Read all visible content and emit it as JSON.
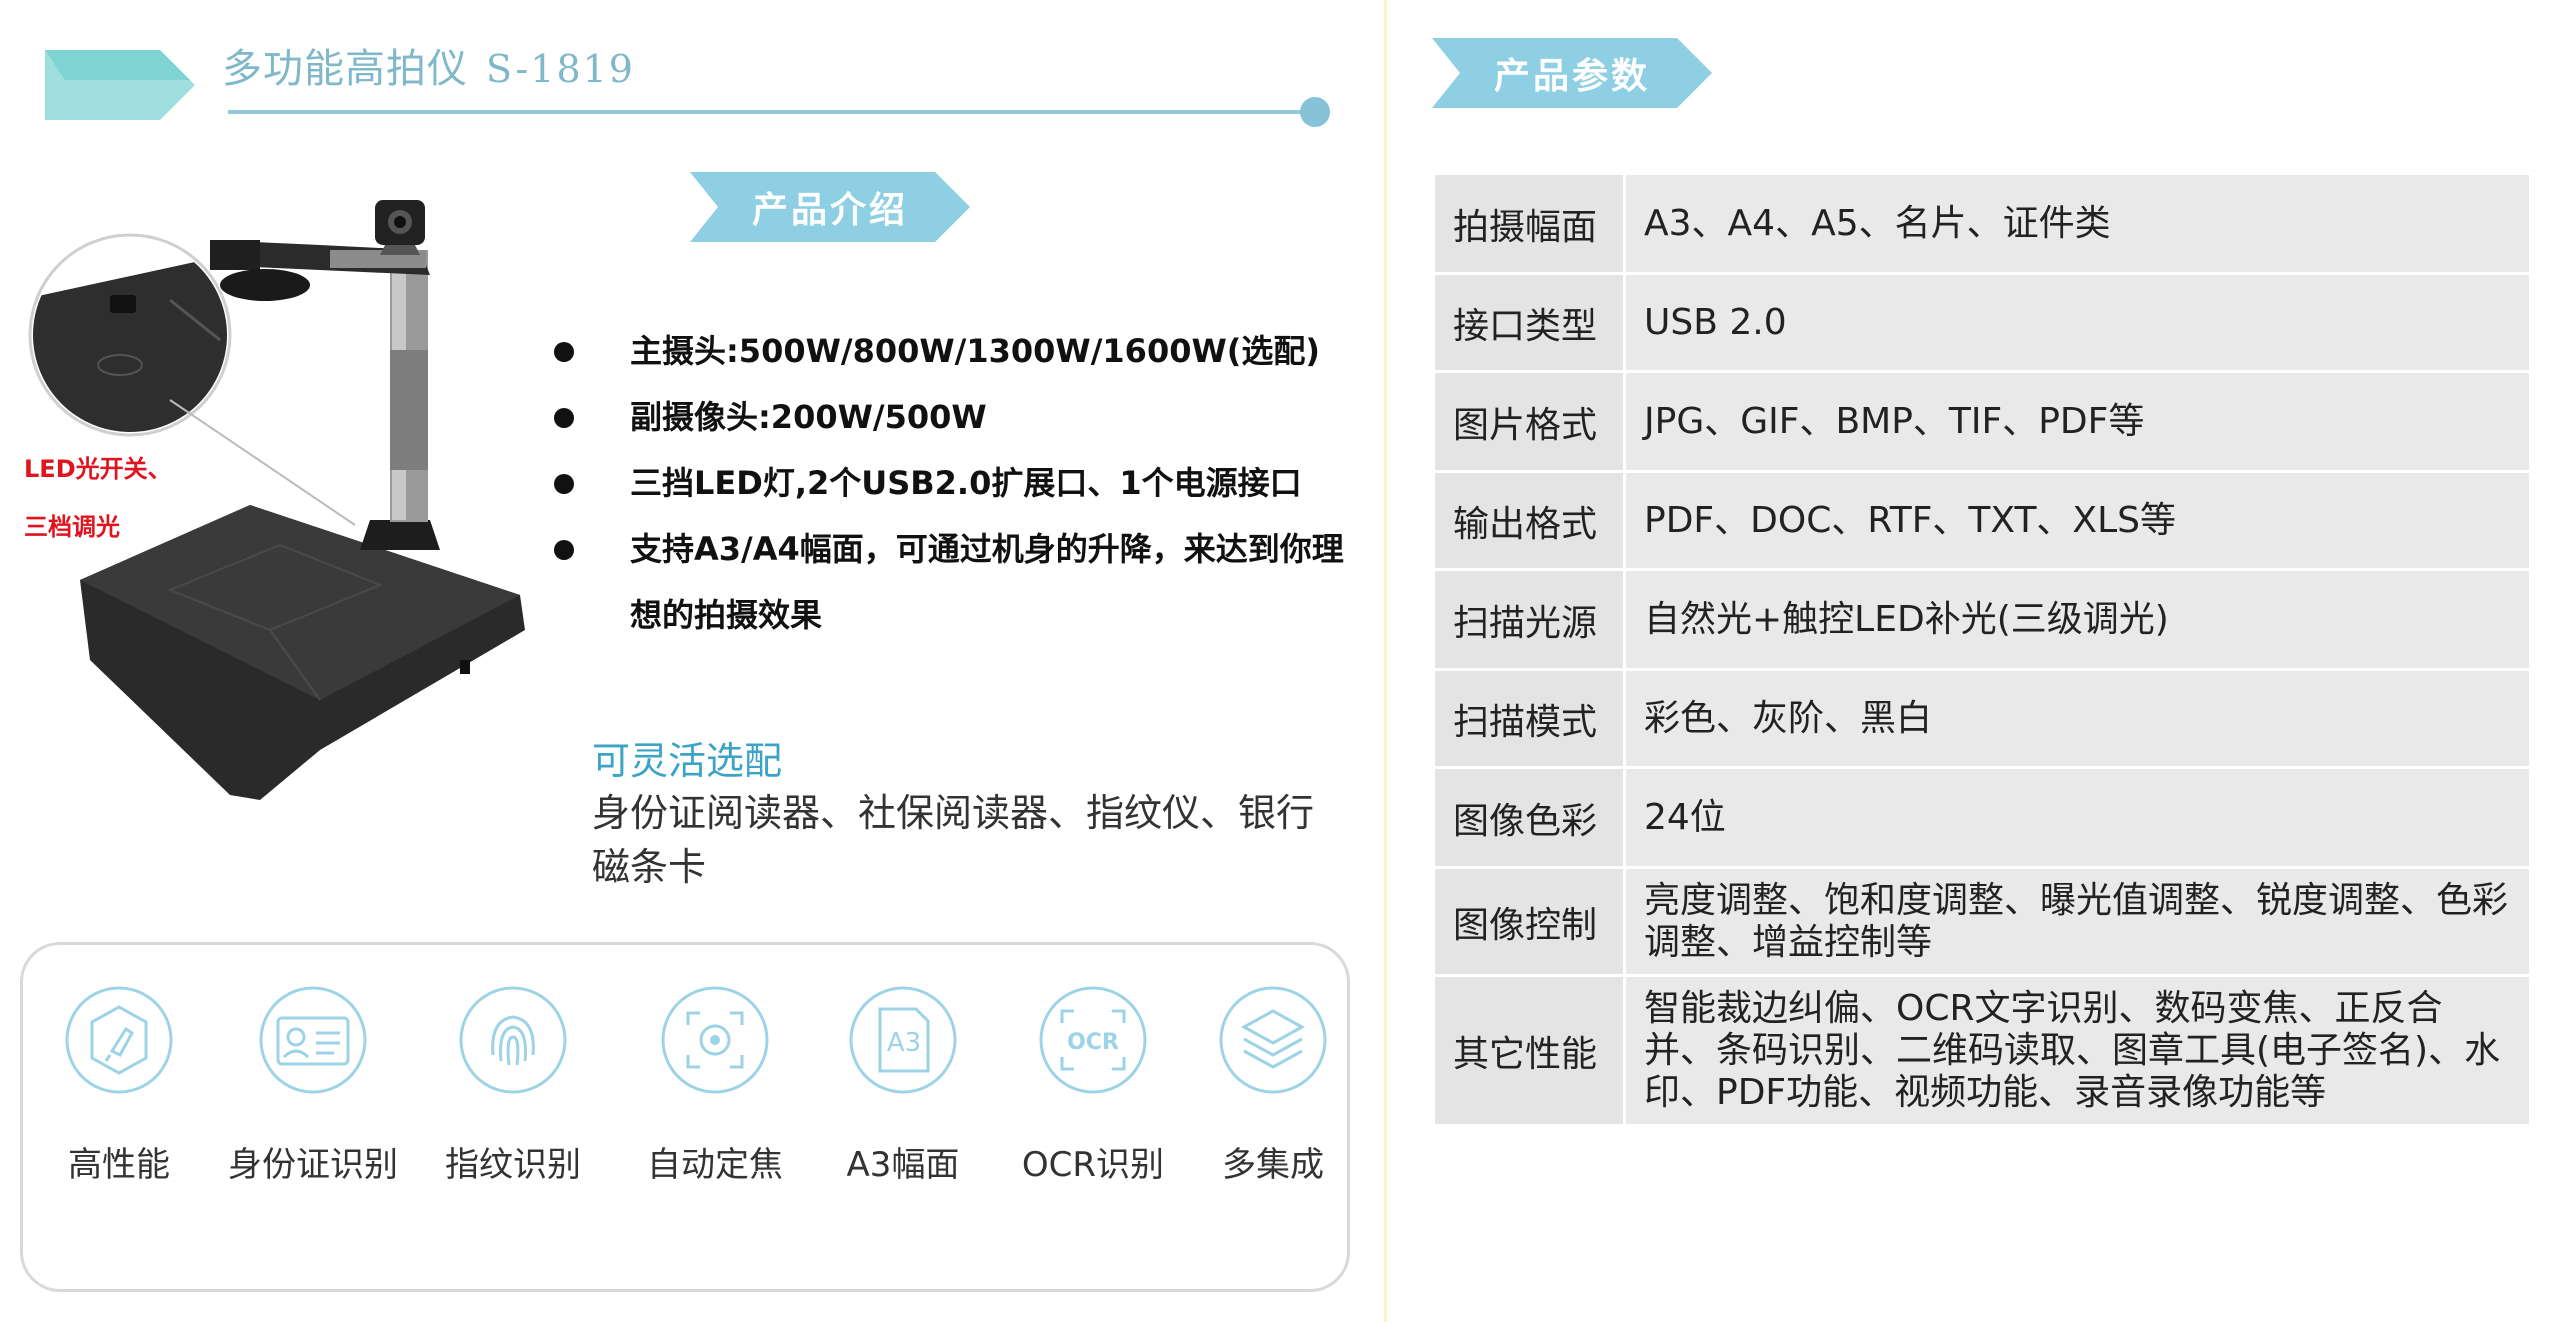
{
  "header": {
    "title": "多功能高拍仪",
    "model": "S-1819"
  },
  "sections": {
    "intro": "产品介绍",
    "params": "产品参数"
  },
  "device_note": {
    "line1": "LED光开关、",
    "line2": "三档调光"
  },
  "features": [
    "主摄头:500W/800W/1300W/1600W(选配)",
    "副摄像头:200W/500W",
    "三挡LED灯,2个USB2.0扩展口、1个电源接口",
    "支持A3/A4幅面，可通过机身的升降，来达到你理想的拍摄效果"
  ],
  "options": {
    "title": "可灵活选配",
    "text": "身份证阅读器、社保阅读器、指纹仪、银行磁条卡"
  },
  "icons": [
    {
      "name": "rocket-icon",
      "label": "高性能"
    },
    {
      "name": "id-card-icon",
      "label": "身份证识别"
    },
    {
      "name": "fingerprint-icon",
      "label": "指纹识别"
    },
    {
      "name": "focus-icon",
      "label": "自动定焦"
    },
    {
      "name": "a3-icon",
      "label": "A3幅面",
      "glyph": "A3"
    },
    {
      "name": "ocr-icon",
      "label": "OCR识别",
      "glyph": "OCR"
    },
    {
      "name": "layers-icon",
      "label": "多集成"
    }
  ],
  "specs": [
    {
      "key": "拍摄幅面",
      "value": "A3、A4、A5、名片、证件类"
    },
    {
      "key": "接口类型",
      "value": "USB 2.0"
    },
    {
      "key": "图片格式",
      "value": "JPG、GIF、BMP、TIF、PDF等"
    },
    {
      "key": "输出格式",
      "value": "PDF、DOC、RTF、TXT、XLS等"
    },
    {
      "key": "扫描光源",
      "value": "自然光+触控LED补光(三级调光)"
    },
    {
      "key": "扫描模式",
      "value": "彩色、灰阶、黑白"
    },
    {
      "key": "图像色彩",
      "value": "24位"
    },
    {
      "key": "图像控制",
      "value": "亮度调整、饱和度调整、曝光值调整、锐度调整、色彩调整、增益控制等"
    },
    {
      "key": "其它性能",
      "value": "智能裁边纠偏、OCR文字识别、数码变焦、正反合并、条码识别、二维码读取、图章工具(电子签名)、水印、PDF功能、视频功能、录音录像功能等"
    }
  ],
  "colors": {
    "accent": "#86c3d8",
    "banner": "#8ecfe3",
    "highlight": "#3aa3c6",
    "alert": "#e0141e"
  }
}
